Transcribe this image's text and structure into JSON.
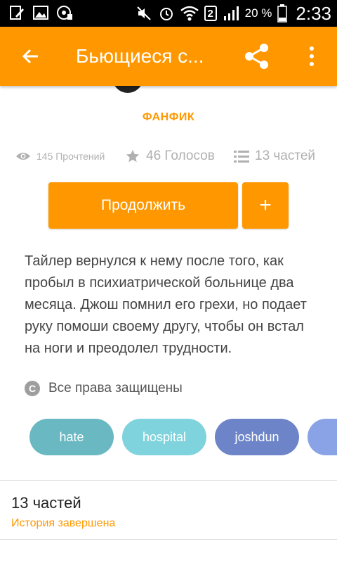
{
  "status_bar": {
    "battery": "20 %",
    "sim_slot": "2",
    "time": "2:33"
  },
  "toolbar": {
    "title": "Бьющиеся с...",
    "back_icon": "arrow-back-icon",
    "share_icon": "share-icon",
    "more_icon": "more-vert-icon"
  },
  "story": {
    "category": "ФАНФИК",
    "reads": "145 Прочтений",
    "votes": "46 Голосов",
    "parts": "13 частей",
    "continue_label": "Продолжить",
    "add_label": "+",
    "description": "Тайлер вернулся к нему после того, как пробыл в психиатрической больнице два месяца. Джош помнил его грехи, но подает руку помоши своему другу, чтобы он встал на ноги и преодолел трудности.",
    "copyright": "Все права защищены",
    "copyright_icon": "copyright-icon"
  },
  "tags": [
    {
      "label": "hate",
      "color": "#69b8c2"
    },
    {
      "label": "hospital",
      "color": "#7fd3dc"
    },
    {
      "label": "joshdun",
      "color": "#6d84c8"
    },
    {
      "label": "",
      "color": "#8aa3e6"
    }
  ],
  "parts_section": {
    "title": "13 частей",
    "status": "История завершена"
  },
  "colors": {
    "accent": "#ff9800",
    "status_bar": "#000000"
  }
}
